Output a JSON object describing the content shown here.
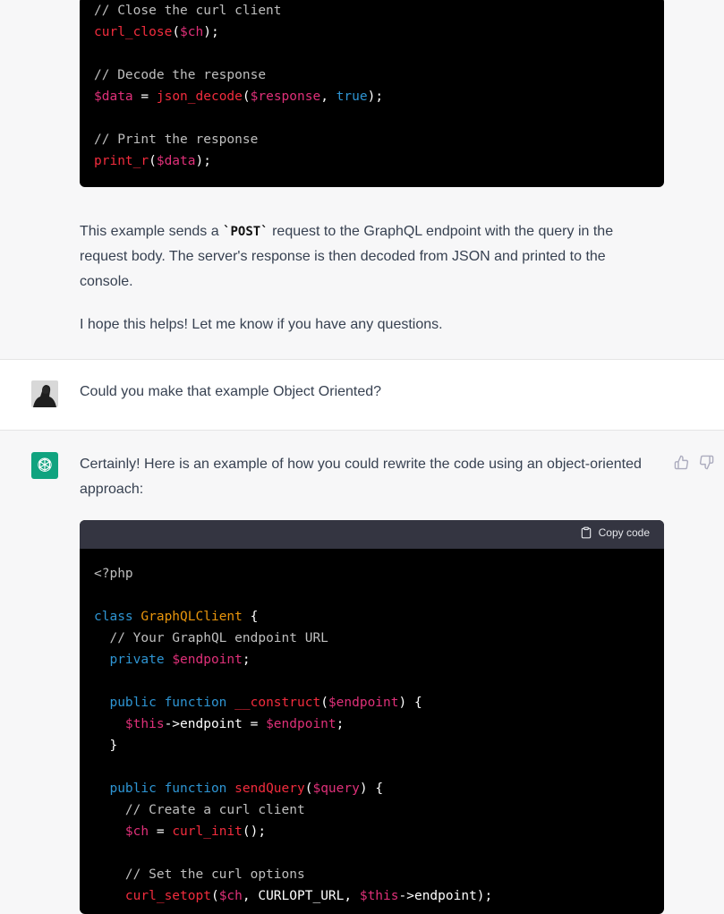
{
  "top_code": {
    "lines": [
      [
        [
          "c",
          "// Close the curl client"
        ]
      ],
      [
        [
          "f",
          "curl_close"
        ],
        [
          "w",
          "("
        ],
        [
          "v",
          "$ch"
        ],
        [
          "w",
          ");"
        ]
      ],
      [],
      [
        [
          "c",
          "// Decode the response"
        ]
      ],
      [
        [
          "v",
          "$data"
        ],
        [
          "w",
          " = "
        ],
        [
          "f",
          "json_decode"
        ],
        [
          "w",
          "("
        ],
        [
          "v",
          "$response"
        ],
        [
          "w",
          ", "
        ],
        [
          "k",
          "true"
        ],
        [
          "w",
          ");"
        ]
      ],
      [],
      [
        [
          "c",
          "// Print the response"
        ]
      ],
      [
        [
          "f",
          "print_r"
        ],
        [
          "w",
          "("
        ],
        [
          "v",
          "$data"
        ],
        [
          "w",
          ");"
        ]
      ]
    ]
  },
  "assistant_msg_1": {
    "para1_before": "This example sends a ",
    "para1_code": "`POST`",
    "para1_after": " request to the GraphQL endpoint with the query in the request body. The server's response is then decoded from JSON and printed to the console.",
    "para2": "I hope this helps! Let me know if you have any questions."
  },
  "user_msg": {
    "text": "Could you make that example Object Oriented?"
  },
  "assistant_msg_2": {
    "intro": "Certainly! Here is an example of how you could rewrite the code using an object-oriented approach:",
    "copy_label": "Copy code"
  },
  "bottom_code": {
    "lines": [
      [
        [
          "c",
          "<?php"
        ]
      ],
      [],
      [
        [
          "k",
          "class "
        ],
        [
          "cl",
          "GraphQLClient"
        ],
        [
          "w",
          " {"
        ]
      ],
      [
        [
          "w",
          "  "
        ],
        [
          "c",
          "// Your GraphQL endpoint URL"
        ]
      ],
      [
        [
          "w",
          "  "
        ],
        [
          "k",
          "private "
        ],
        [
          "v",
          "$endpoint"
        ],
        [
          "w",
          ";"
        ]
      ],
      [],
      [
        [
          "w",
          "  "
        ],
        [
          "k",
          "public function "
        ],
        [
          "f",
          "__construct"
        ],
        [
          "w",
          "("
        ],
        [
          "v",
          "$endpoint"
        ],
        [
          "w",
          ") {"
        ]
      ],
      [
        [
          "w",
          "    "
        ],
        [
          "v",
          "$this"
        ],
        [
          "w",
          "->endpoint = "
        ],
        [
          "v",
          "$endpoint"
        ],
        [
          "w",
          ";"
        ]
      ],
      [
        [
          "w",
          "  }"
        ]
      ],
      [],
      [
        [
          "w",
          "  "
        ],
        [
          "k",
          "public function "
        ],
        [
          "f",
          "sendQuery"
        ],
        [
          "w",
          "("
        ],
        [
          "v",
          "$query"
        ],
        [
          "w",
          ") {"
        ]
      ],
      [
        [
          "w",
          "    "
        ],
        [
          "c",
          "// Create a curl client"
        ]
      ],
      [
        [
          "w",
          "    "
        ],
        [
          "v",
          "$ch"
        ],
        [
          "w",
          " = "
        ],
        [
          "f",
          "curl_init"
        ],
        [
          "w",
          "();"
        ]
      ],
      [],
      [
        [
          "w",
          "    "
        ],
        [
          "c",
          "// Set the curl options"
        ]
      ],
      [
        [
          "w",
          "    "
        ],
        [
          "f",
          "curl_setopt"
        ],
        [
          "w",
          "("
        ],
        [
          "v",
          "$ch"
        ],
        [
          "w",
          ", CURLOPT_URL, "
        ],
        [
          "v",
          "$this"
        ],
        [
          "w",
          "->endpoint);"
        ]
      ]
    ]
  },
  "icons": {
    "copy": "clipboard-icon",
    "like": "thumbs-up-icon",
    "dislike": "thumbs-down-icon",
    "assistant": "openai-logo-icon",
    "user": "user-avatar"
  },
  "colors": {
    "assistant_avatar": "#10a37f",
    "code_bg": "#000000",
    "code_header": "#343541"
  }
}
